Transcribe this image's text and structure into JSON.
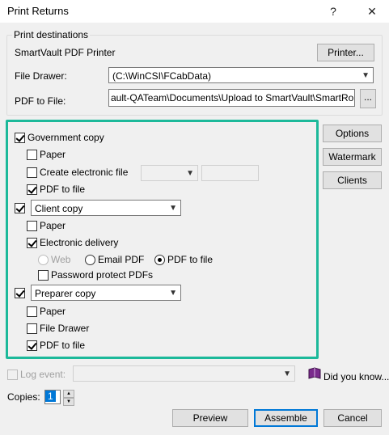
{
  "window": {
    "title": "Print Returns",
    "help_label": "?",
    "close_label": "✕"
  },
  "destinations": {
    "legend": "Print destinations",
    "printer_name": "SmartVault PDF Printer",
    "printer_button": "Printer...",
    "file_drawer_label": "File Drawer:",
    "file_drawer_value": "(C:\\WinCSI\\FCabData)",
    "pdf_label": "PDF to File:",
    "pdf_path": "ault-QATeam\\Documents\\Upload to SmartVault\\SmartRouting\\",
    "browse_label": "..."
  },
  "sections": {
    "government": {
      "label": "Government copy",
      "paper": "Paper",
      "electronic": "Create electronic file",
      "pdf": "PDF to file"
    },
    "client": {
      "select_value": "Client copy",
      "paper": "Paper",
      "delivery": "Electronic delivery",
      "web": "Web",
      "email": "Email PDF",
      "pdffile": "PDF to file",
      "password": "Password protect PDFs"
    },
    "preparer": {
      "select_value": "Preparer copy",
      "paper": "Paper",
      "drawer": "File Drawer",
      "pdf": "PDF to file"
    }
  },
  "side_buttons": {
    "options": "Options",
    "watermark": "Watermark",
    "clients": "Clients"
  },
  "footer": {
    "log_event": "Log event:",
    "did_you_know": "Did you know...",
    "copies_label": "Copies:",
    "copies_value": "1",
    "preview": "Preview",
    "assemble": "Assemble",
    "cancel": "Cancel"
  },
  "colors": {
    "highlight": "#1cb99a",
    "accent": "#0078d7"
  }
}
